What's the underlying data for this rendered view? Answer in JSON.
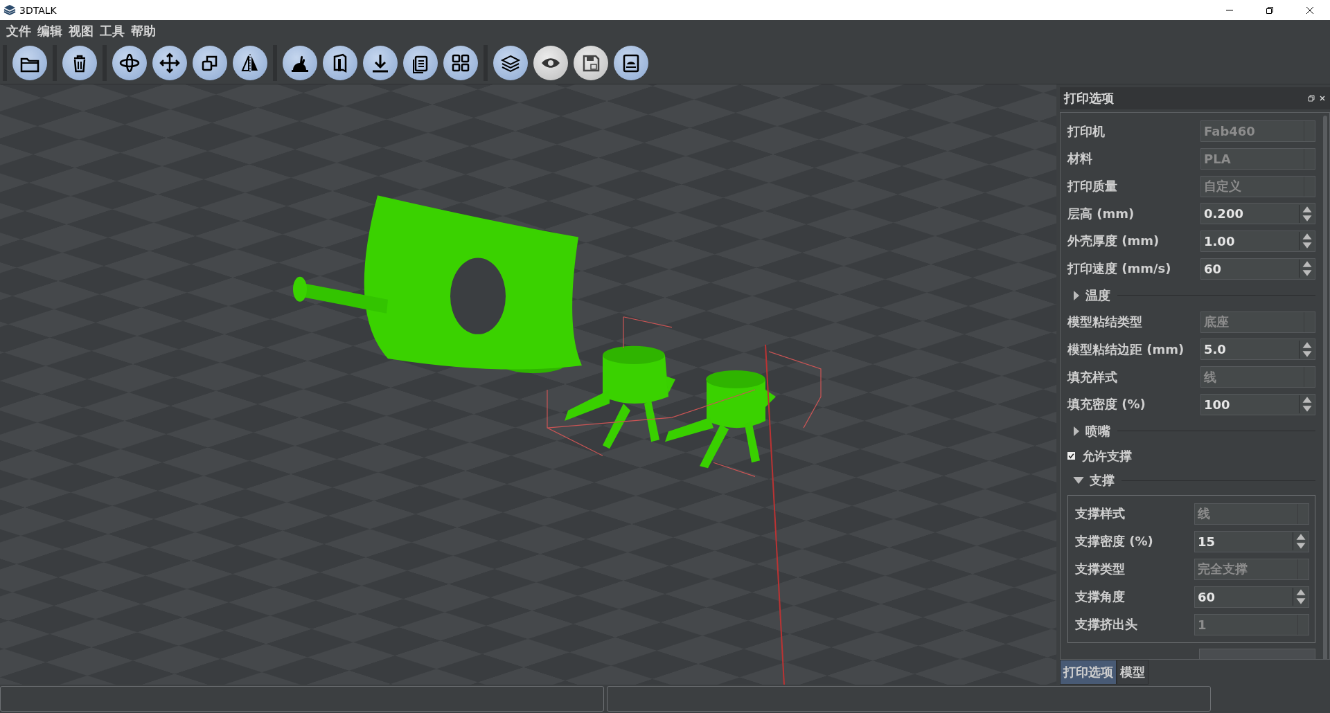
{
  "window": {
    "title": "3DTALK"
  },
  "menu": [
    "文件",
    "编辑",
    "视图",
    "工具",
    "帮助"
  ],
  "toolbar": [
    [
      {
        "kind": "open",
        "disabled": false
      }
    ],
    [
      {
        "kind": "delete",
        "disabled": false
      }
    ],
    [
      {
        "kind": "rotate",
        "disabled": false
      },
      {
        "kind": "move",
        "disabled": false
      },
      {
        "kind": "scale",
        "disabled": false
      },
      {
        "kind": "mirror",
        "disabled": false
      }
    ],
    [
      {
        "kind": "rabbit",
        "disabled": false
      },
      {
        "kind": "book",
        "disabled": false
      },
      {
        "kind": "download",
        "disabled": false
      },
      {
        "kind": "copy",
        "disabled": false
      },
      {
        "kind": "grid",
        "disabled": false
      }
    ],
    [
      {
        "kind": "layers",
        "disabled": false
      },
      {
        "kind": "eye",
        "disabled": true
      },
      {
        "kind": "save",
        "disabled": true
      },
      {
        "kind": "printer",
        "disabled": false
      }
    ]
  ],
  "panel": {
    "title": "打印选项",
    "rows": [
      {
        "kind": "combo",
        "label": "打印机",
        "value": "Fab460"
      },
      {
        "kind": "combo",
        "label": "材料",
        "value": "PLA"
      },
      {
        "kind": "combo",
        "label": "打印质量",
        "value": "自定义"
      },
      {
        "kind": "spin",
        "label": "层高 (mm)",
        "value": "0.200"
      },
      {
        "kind": "spin",
        "label": "外壳厚度 (mm)",
        "value": "1.00"
      },
      {
        "kind": "spin",
        "label": "打印速度 (mm/s)",
        "value": "60"
      },
      {
        "kind": "section",
        "label": "温度",
        "expanded": false
      },
      {
        "kind": "combo",
        "label": "模型粘结类型",
        "value": "底座"
      },
      {
        "kind": "spin",
        "label": "模型粘结边距 (mm)",
        "value": "5.0"
      },
      {
        "kind": "combo",
        "label": "填充样式",
        "value": "线"
      },
      {
        "kind": "spin",
        "label": "填充密度 (%)",
        "value": "100"
      },
      {
        "kind": "section",
        "label": "喷嘴",
        "expanded": false
      },
      {
        "kind": "checkbox",
        "label": "允许支撑",
        "checked": true
      },
      {
        "kind": "section",
        "label": "支撑",
        "expanded": true,
        "children": [
          {
            "kind": "combo",
            "label": "支撑样式",
            "value": "线"
          },
          {
            "kind": "spin",
            "label": "支撑密度 (%)",
            "value": "15"
          },
          {
            "kind": "combo",
            "label": "支撑类型",
            "value": "完全支撑"
          },
          {
            "kind": "spin",
            "label": "支撑角度",
            "value": "60"
          },
          {
            "kind": "combo",
            "label": "支撑挤出头",
            "value": "1"
          }
        ]
      }
    ],
    "tabs": [
      {
        "label": "打印选项",
        "selected": true
      },
      {
        "label": "模型",
        "selected": false
      }
    ]
  }
}
